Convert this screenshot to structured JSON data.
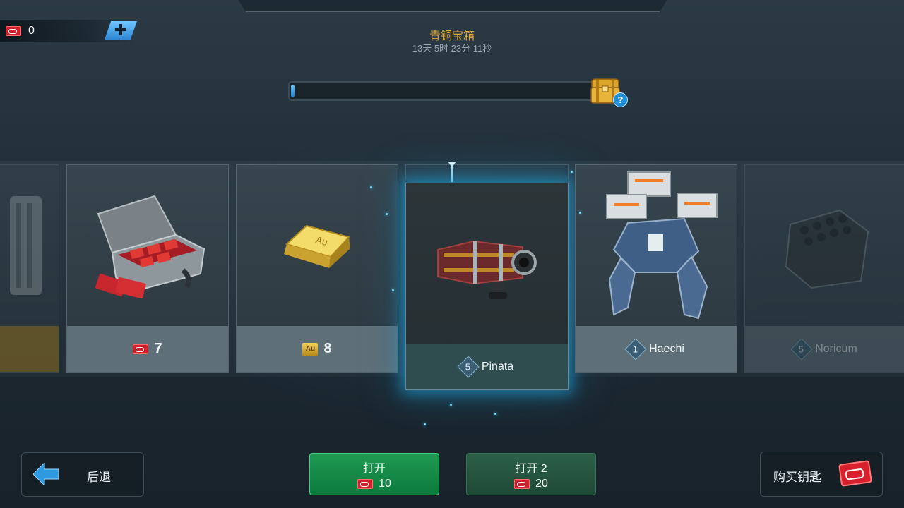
{
  "header": {
    "key_count": "0",
    "add_keys_symbol": "✚",
    "chest_title": "青铜宝箱",
    "timer": "13天 5时 23分 11秒",
    "help_symbol": "?",
    "progress_fraction": 0.01
  },
  "reel": {
    "cards": [
      {
        "id": "partial-left",
        "value": ""
      },
      {
        "id": "key-case",
        "value": "7",
        "icon": "key-icon"
      },
      {
        "id": "gold",
        "value": "8",
        "icon": "gold-icon"
      },
      {
        "id": "pinata",
        "level": "5",
        "name": "Pinata",
        "selected": true
      },
      {
        "id": "haechi",
        "level": "1",
        "name": "Haechi"
      },
      {
        "id": "noricum",
        "level": "5",
        "name": "Noricum"
      }
    ]
  },
  "buttons": {
    "back_label": "后退",
    "open_label": "打开",
    "open_cost": "10",
    "open2_label": "打开 2",
    "open2_cost": "20",
    "buy_keys_label": "购买钥匙"
  },
  "colors": {
    "accent_gold": "#e0a838",
    "accent_blue": "#1f8fd9",
    "open_green": "#0c7a3c",
    "key_red": "#d11f2c"
  }
}
